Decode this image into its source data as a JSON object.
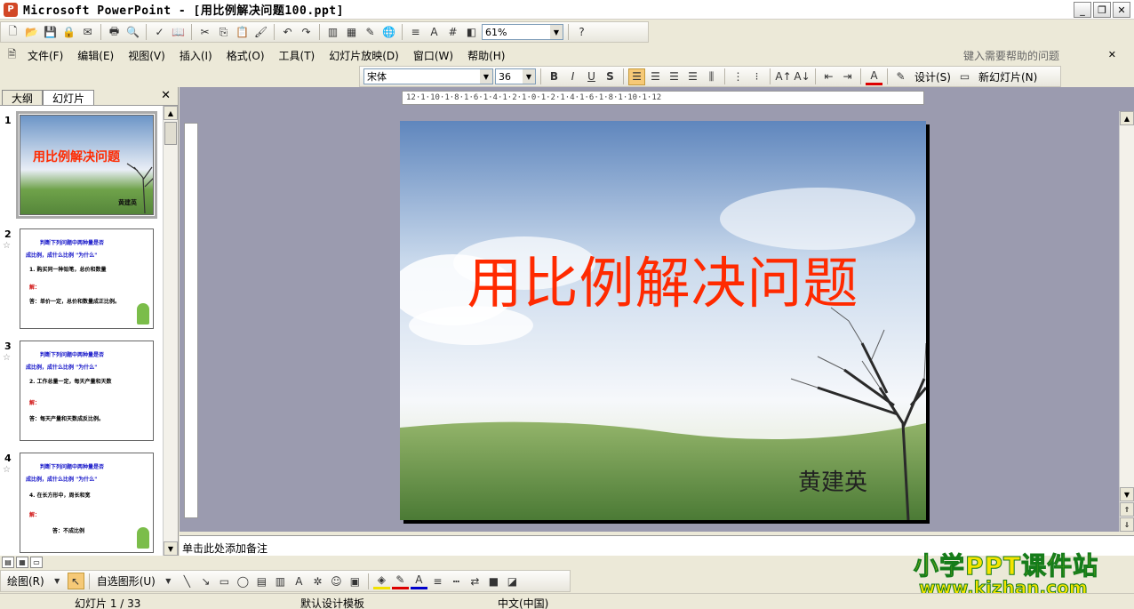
{
  "window": {
    "title": "Microsoft PowerPoint - [用比例解决问题100.ppt]",
    "buttons": [
      "_",
      "❐",
      "✕"
    ]
  },
  "standard_toolbar": {
    "zoom": "61%"
  },
  "menu": {
    "items": [
      "文件(F)",
      "编辑(E)",
      "视图(V)",
      "插入(I)",
      "格式(O)",
      "工具(T)",
      "幻灯片放映(D)",
      "窗口(W)",
      "帮助(H)"
    ],
    "help_placeholder": "键入需要帮助的问题"
  },
  "format_toolbar": {
    "font": "宋体",
    "size": "36",
    "bold": "B",
    "italic": "I",
    "underline": "U",
    "shadow": "S",
    "design_label": "设计(S)",
    "new_slide_label": "新幻灯片(N)"
  },
  "pane": {
    "tabs": [
      "大纲",
      "幻灯片"
    ],
    "close": "✕",
    "slides": [
      {
        "num": "1",
        "title": "用比例解决问题",
        "author": "黄建英"
      },
      {
        "num": "2",
        "lines": [
          "判断下列问题中两种量是否",
          "成比例，成什么比例 \"为什么\"",
          "1. 购买同一种铅笔，总价和数量",
          "解：",
          "答：单价一定，总价和数量成正比例。"
        ]
      },
      {
        "num": "3",
        "lines": [
          "判断下列问题中两种量是否",
          "成比例，成什么比例 \"为什么\"",
          "2. 工作总量一定，每天产量和天数",
          "解：",
          "答：每天产量和天数成反比例。"
        ]
      },
      {
        "num": "4",
        "lines": [
          "判断下列问题中两种量是否",
          "成比例，成什么比例 \"为什么\"",
          "4. 在长方形中，周长和宽",
          "解：",
          "答：不成比例"
        ]
      }
    ]
  },
  "ruler_h": "12·1·10·1·8·1·6·1·4·1·2·1·0·1·2·1·4·1·6·1·8·1·10·1·12",
  "slide": {
    "title": "用比例解决问题",
    "author": "黄建英"
  },
  "notes_placeholder": "单击此处添加备注",
  "draw_toolbar": {
    "draw_label": "绘图(R)",
    "autoshapes_label": "自选图形(U)"
  },
  "watermark": {
    "line1": "小学PPT课件站",
    "line2": "www.kjzhan.com"
  },
  "status": {
    "slide_count": "幻灯片 1 / 33",
    "template": "默认设计模板",
    "language": "中文(中国)"
  },
  "colors": {
    "slide_title": "#ff2a00",
    "workspace": "#9b9baf",
    "watermark_fill": "#f4e400",
    "watermark_stroke": "#157c1a"
  }
}
